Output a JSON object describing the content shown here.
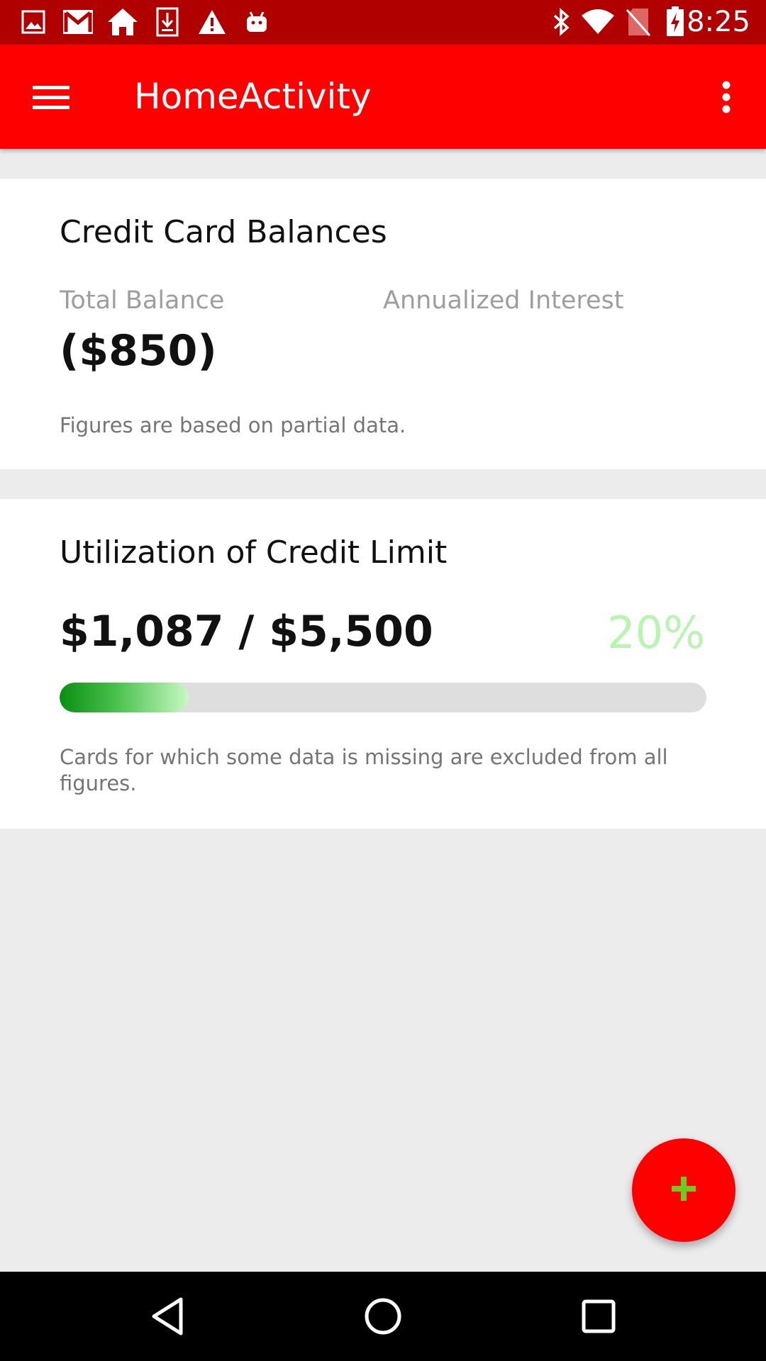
{
  "status_bar": {
    "time": "8:25",
    "left_icons": [
      "gallery-icon",
      "gmail-icon",
      "home-icon",
      "download-icon",
      "alert-icon",
      "android-icon"
    ],
    "right_icons": [
      "bluetooth-icon",
      "wifi-icon",
      "no-sim-icon",
      "battery-charging-icon"
    ],
    "background": "#b10000"
  },
  "app_bar": {
    "title": "HomeActivity",
    "menu_icon": "hamburger-menu-icon",
    "overflow_icon": "more-vert-icon",
    "background": "#ff0000"
  },
  "balances_card": {
    "title": "Credit Card Balances",
    "total_balance_label": "Total Balance",
    "total_balance_value": "($850)",
    "interest_label": "Annualized Interest",
    "interest_value": "",
    "note": "Figures are based on partial data."
  },
  "utilization_card": {
    "title": "Utilization of Credit Limit",
    "amount": "$1,087 / $5,500",
    "percent": "20%",
    "progress_fraction": 0.2,
    "note": "Cards for which some data is missing are excluded from all figures.",
    "percent_color": "#b7f5b0"
  },
  "fab": {
    "icon": "plus-icon",
    "icon_color": "#6ccc1e",
    "background": "#ff0000"
  },
  "nav_bar": {
    "buttons": [
      "back-icon",
      "home-circle-icon",
      "recents-icon"
    ]
  }
}
